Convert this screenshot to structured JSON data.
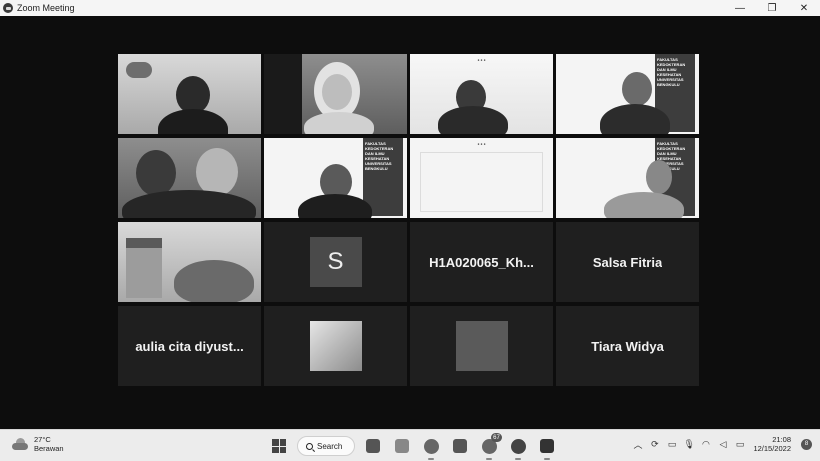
{
  "window": {
    "title": "Zoom Meeting",
    "controls": [
      "—",
      "❐",
      "✕"
    ]
  },
  "participants": [
    {
      "type": "video",
      "scene": "man-glasses"
    },
    {
      "type": "video",
      "scene": "woman-hijab-smile",
      "active": true
    },
    {
      "type": "video",
      "scene": "slide-woman"
    },
    {
      "type": "video",
      "scene": "banner-man"
    },
    {
      "type": "video",
      "scene": "two-women"
    },
    {
      "type": "video",
      "scene": "banner-woman"
    },
    {
      "type": "video",
      "scene": "slide-blank"
    },
    {
      "type": "video",
      "scene": "woman-slide-right"
    },
    {
      "type": "video",
      "scene": "room-hand"
    },
    {
      "type": "avatar",
      "initial": "S"
    },
    {
      "type": "name",
      "name": "H1A020065_Kh..."
    },
    {
      "type": "name",
      "name": "Salsa Fitria"
    },
    {
      "type": "name",
      "name": "aulia cita diyust..."
    },
    {
      "type": "avatar-photo"
    },
    {
      "type": "avatar-grey"
    },
    {
      "type": "name",
      "name": "Tiara Widya"
    }
  ],
  "banner": {
    "text": "FAKULTAS KEDOKTERAN DAN ILMU KESEHATAN UNIVERSITAS BENGKULU"
  },
  "taskbar": {
    "weather": {
      "temp": "27°C",
      "condition": "Berawan"
    },
    "search_label": "Search",
    "badge_count": "67",
    "clock": {
      "time": "21:08",
      "date": "12/15/2022"
    },
    "notification_count": "8"
  }
}
